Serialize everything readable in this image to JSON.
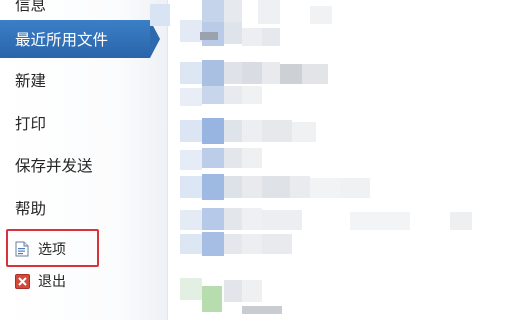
{
  "nav": {
    "cut_top_label": "信息",
    "recent_label": "最近所用文件",
    "new_label": "新建",
    "print_label": "打印",
    "save_send_label": "保存并发送",
    "help_label": "帮助",
    "options_label": "选项",
    "exit_label": "退出"
  },
  "colors": {
    "active_bg": "#2f6db3",
    "highlight_border": "#d9323a",
    "exit_icon": "#d44a3a"
  },
  "icons": {
    "options": "document-options-icon",
    "exit": "exit-x-icon"
  }
}
